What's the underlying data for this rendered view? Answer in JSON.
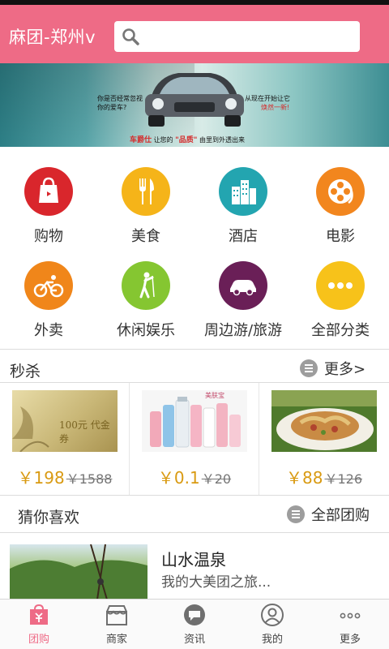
{
  "header": {
    "city_label": "麻团-郑州v",
    "search_placeholder": ""
  },
  "banner": {
    "text_left": "你是否经常忽视\n你的爱车?",
    "text_right_1": "从现在开始让它",
    "text_right_2": "焕然一新!",
    "slogan_brand": "车爵仕",
    "slogan_mid": "让您的",
    "slogan_quote": "\"品质\"",
    "slogan_end": "由里到外透出来"
  },
  "categories": [
    {
      "label": "购物",
      "icon": "shopping-bag-icon",
      "color": "#d9262c"
    },
    {
      "label": "美食",
      "icon": "fork-knife-icon",
      "color": "#f5b419"
    },
    {
      "label": "酒店",
      "icon": "hotel-buildings-icon",
      "color": "#23a5b0"
    },
    {
      "label": "电影",
      "icon": "film-reel-icon",
      "color": "#f2861e"
    },
    {
      "label": "外卖",
      "icon": "bicycle-icon",
      "color": "#f0861a"
    },
    {
      "label": "休闲娱乐",
      "icon": "golf-player-icon",
      "color": "#85c631"
    },
    {
      "label": "周边游/旅游",
      "icon": "car-icon",
      "color": "#6a1f57"
    },
    {
      "label": "全部分类",
      "icon": "more-dots-icon",
      "color": "#f7c21a"
    }
  ],
  "seckill": {
    "title": "秒杀",
    "more_label": "更多>",
    "items": [
      {
        "price": "￥198",
        "old_price": "￥1588",
        "image": "voucher-card-image",
        "image_text": "100元 代金券"
      },
      {
        "price": "￥0.1",
        "old_price": "￥20",
        "image": "cosmetics-bottles-image",
        "image_text": "美肤宝"
      },
      {
        "price": "￥88",
        "old_price": "￥126",
        "image": "food-dish-image",
        "image_text": ""
      }
    ]
  },
  "guess": {
    "title": "猜你喜欢",
    "all_label": "全部团购",
    "item_title": "山水温泉",
    "item_desc": "我的大美团之旅..."
  },
  "tabs": [
    {
      "label": "团购",
      "icon": "tuan-icon",
      "active": true
    },
    {
      "label": "商家",
      "icon": "shop-icon",
      "active": false
    },
    {
      "label": "资讯",
      "icon": "chat-bubble-icon",
      "active": false
    },
    {
      "label": "我的",
      "icon": "user-icon",
      "active": false
    },
    {
      "label": "更多",
      "icon": "more-dots-icon",
      "active": false
    }
  ],
  "colors": {
    "brand": "#ee6b86",
    "price": "#d99a12"
  }
}
